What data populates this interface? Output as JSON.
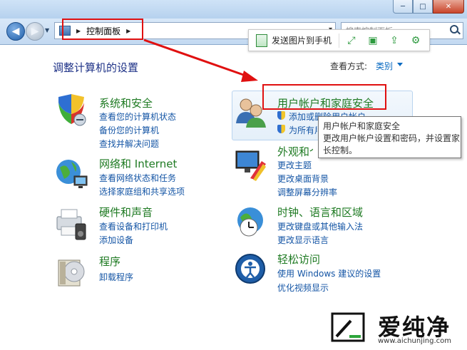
{
  "window": {
    "min_label": "─",
    "max_label": "□",
    "close_label": "✕"
  },
  "nav": {
    "back_icon": "back-arrow-icon",
    "forward_icon": "forward-arrow-icon",
    "crumb": "控制面板",
    "search_placeholder": "搜索控制面板"
  },
  "floatbar": {
    "send_label": "发送图片到手机"
  },
  "header": {
    "title": "调整计算机的设置",
    "view_by_label": "查看方式:",
    "view_by_value": "类别"
  },
  "categories": [
    {
      "title": "系统和安全",
      "links": [
        "查看您的计算机状态",
        "备份您的计算机",
        "查找并解决问题"
      ]
    },
    {
      "title": "网络和 Internet",
      "links": [
        "查看网络状态和任务",
        "选择家庭组和共享选项"
      ]
    },
    {
      "title": "硬件和声音",
      "links": [
        "查看设备和打印机",
        "添加设备"
      ]
    },
    {
      "title": "程序",
      "links": [
        "卸载程序"
      ]
    },
    {
      "title": "用户帐户和家庭安全",
      "links": [
        "添加或删除用户帐户",
        "为所有用户设置家长控制"
      ]
    },
    {
      "title": "外观和个性化",
      "links": [
        "更改主题",
        "更改桌面背景",
        "调整屏幕分辨率"
      ]
    },
    {
      "title": "时钟、语言和区域",
      "links": [
        "更改键盘或其他输入法",
        "更改显示语言"
      ]
    },
    {
      "title": "轻松访问",
      "links": [
        "使用 Windows 建议的设置",
        "优化视频显示"
      ]
    }
  ],
  "tooltip": {
    "line1": "用户帐户和家庭安全",
    "line2": "更改用户帐户设置和密码，并设置家",
    "line3": "长控制。"
  },
  "watermark": {
    "brand": "爱纯净",
    "url": "www.aichunjing.com"
  },
  "colors": {
    "category_title": "#1e7a22",
    "link": "#1455a5",
    "annotation": "#e01010"
  }
}
